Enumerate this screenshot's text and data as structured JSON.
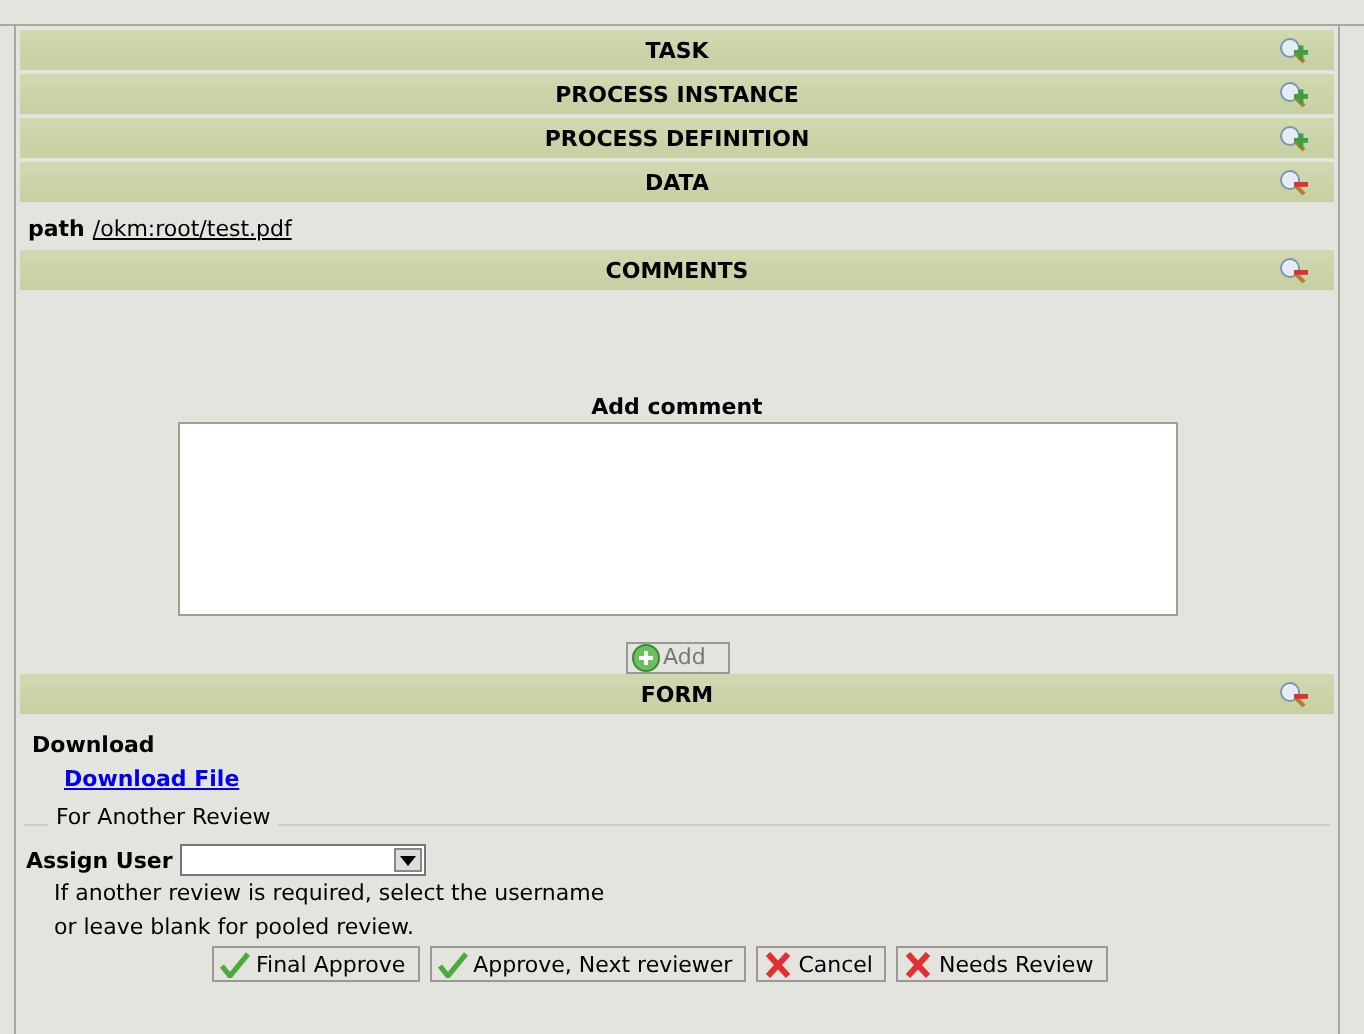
{
  "sections": [
    {
      "title": "TASK",
      "expanded": false
    },
    {
      "title": "PROCESS INSTANCE",
      "expanded": false
    },
    {
      "title": "PROCESS DEFINITION",
      "expanded": false
    },
    {
      "title": "DATA",
      "expanded": true
    },
    {
      "title": "COMMENTS",
      "expanded": true
    },
    {
      "title": "FORM",
      "expanded": true
    }
  ],
  "data": {
    "label": "path",
    "link": "/okm:root/test.pdf"
  },
  "comments": {
    "label": "Add comment",
    "add_button": {
      "label": "Add",
      "disabled": true
    }
  },
  "form": {
    "download_label": "Download",
    "download_link": "Download File",
    "fieldset": "For Another Review",
    "assign_label": "Assign User",
    "help": [
      "If another review is required, select the username",
      "or leave blank for pooled review."
    ],
    "buttons": [
      {
        "label": "Final Approve",
        "kind": "approve"
      },
      {
        "label": "Approve, Next reviewer",
        "kind": "approve"
      },
      {
        "label": "Cancel",
        "kind": "reject"
      },
      {
        "label": "Needs Review",
        "kind": "reject"
      }
    ]
  }
}
